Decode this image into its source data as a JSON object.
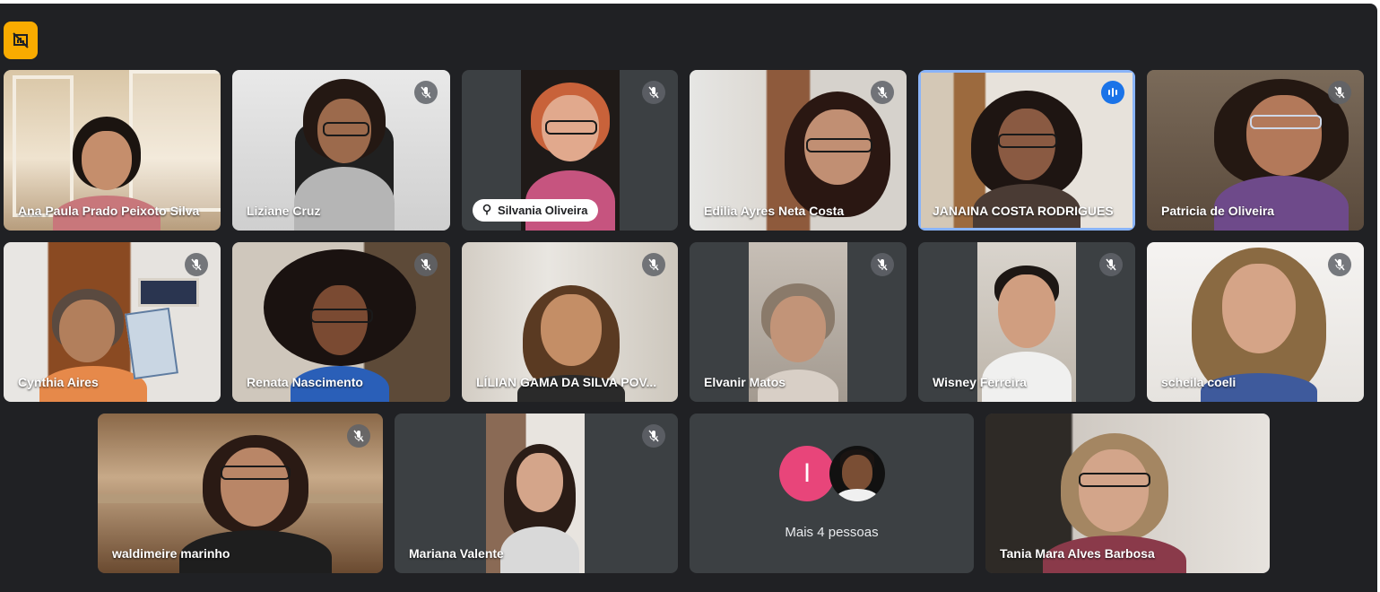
{
  "meeting": {
    "badge_icon": "presentation-off-icon",
    "participants": [
      {
        "name": "Ana Paula Prado Peixoto Silva",
        "muted": false
      },
      {
        "name": "Liziane Cruz",
        "muted": true
      },
      {
        "name": "Silvania Oliveira",
        "muted": true
      },
      {
        "name": "Edilia Ayres Neta Costa",
        "muted": true
      },
      {
        "name": "JANAINA COSTA RODRIGUES",
        "muted": false,
        "speaking": true
      },
      {
        "name": "Patricia de Oliveira",
        "muted": true
      },
      {
        "name": "Cynthia Aires",
        "muted": true
      },
      {
        "name": "Renata Nascimento",
        "muted": true
      },
      {
        "name": "LÍLIAN GAMA DA SILVA POV...",
        "muted": true
      },
      {
        "name": "Elvanir Matos",
        "muted": true
      },
      {
        "name": "Wisney Ferreira",
        "muted": true
      },
      {
        "name": "scheila coeli",
        "muted": true
      },
      {
        "name": "waldimeire marinho",
        "muted": true
      },
      {
        "name": "Mariana Valente",
        "muted": true
      },
      {
        "name": "Tania Mara Alves Barbosa",
        "muted": false
      }
    ],
    "more": {
      "avatar_initial": "I",
      "label": "Mais 4 pessoas"
    },
    "colors": {
      "background": "#202124",
      "tile": "#3c4043",
      "active_border": "#8ab4f8",
      "speaking": "#1a73e8",
      "badge": "#f9ab00",
      "avatar_initial_bg": "#e8457a"
    }
  }
}
